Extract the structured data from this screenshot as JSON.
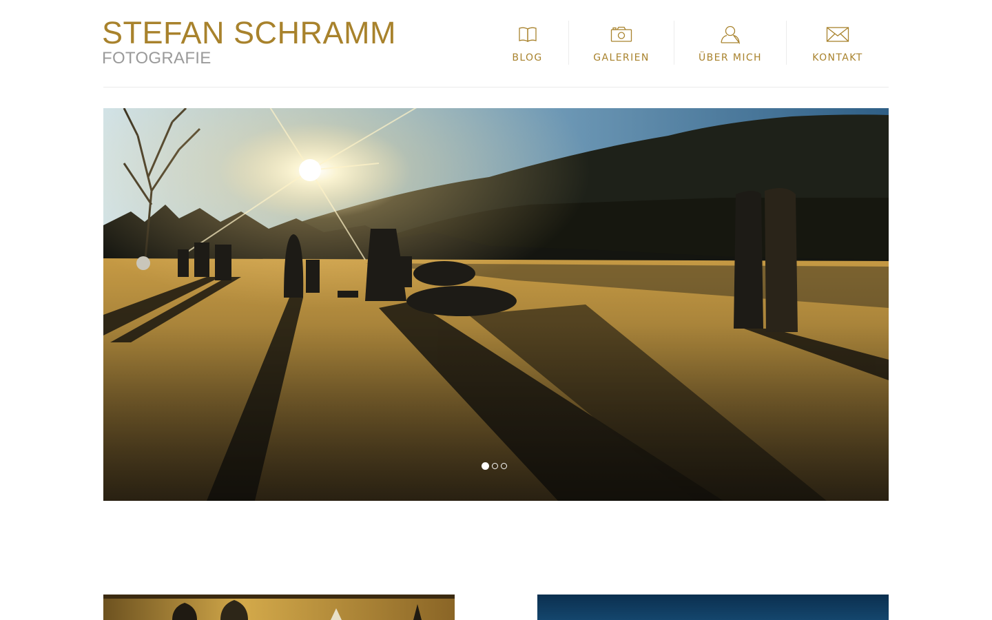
{
  "brand": {
    "title": "STEFAN SCHRAMM",
    "subtitle": "FOTOGRAFIE"
  },
  "colors": {
    "accent": "#a8822c",
    "muted": "#9a9a9a",
    "rule": "#e9e9e9"
  },
  "nav": [
    {
      "label": "BLOG",
      "icon": "book-icon"
    },
    {
      "label": "GALERIEN",
      "icon": "camera-icon"
    },
    {
      "label": "ÜBER MICH",
      "icon": "user-icon"
    },
    {
      "label": "KONTAKT",
      "icon": "envelope-icon"
    }
  ],
  "slider": {
    "slide_count": 3,
    "active_index": 0
  }
}
